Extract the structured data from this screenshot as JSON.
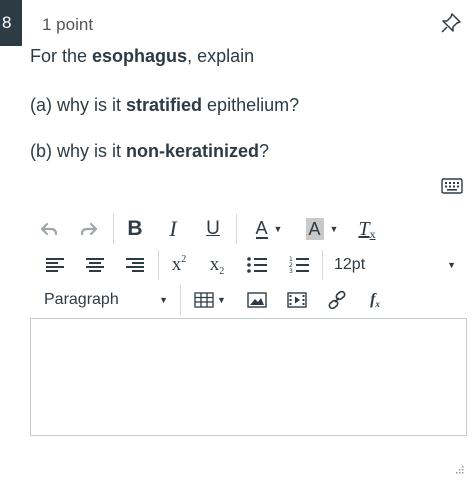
{
  "question": {
    "number": "8",
    "points": "1 point",
    "line1_prefix": "For the ",
    "line1_bold": "esophagus",
    "line1_suffix": ", explain",
    "line2_prefix": "(a) why is it ",
    "line2_bold": "stratified",
    "line2_suffix": " epithelium?",
    "line3_prefix": "(b) why is it ",
    "line3_bold": "non-keratinized",
    "line3_suffix": "?"
  },
  "toolbar": {
    "bold": "B",
    "italic": "I",
    "underline": "U",
    "font_color": "A",
    "bg_color": "A",
    "clear_format": "T",
    "clear_format_sub": "x",
    "superscript_base": "x",
    "superscript_mark": "2",
    "subscript_base": "x",
    "subscript_mark": "2",
    "font_size": "12pt",
    "block_format": "Paragraph",
    "formula": "f",
    "formula_sub": "x"
  },
  "colors": {
    "question_number_bg": "#2d3b45",
    "text": "#2d3b45",
    "icon_muted": "#a0a6aa",
    "highlight_bg": "#c9c9c9"
  }
}
